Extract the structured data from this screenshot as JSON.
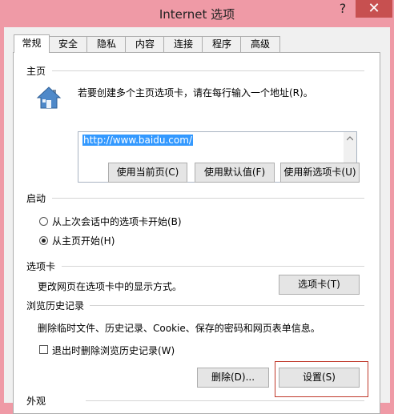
{
  "window": {
    "title": "Internet 选项",
    "help_glyph": "?",
    "close_glyph": "✕"
  },
  "tabs": [
    {
      "label": "常规",
      "active": true
    },
    {
      "label": "安全"
    },
    {
      "label": "隐私"
    },
    {
      "label": "内容"
    },
    {
      "label": "连接"
    },
    {
      "label": "程序"
    },
    {
      "label": "高级"
    }
  ],
  "home": {
    "title": "主页",
    "instruction": "若要创建多个主页选项卡，请在每行输入一个地址(R)。",
    "url": "http://www.baidu.com/",
    "buttons": {
      "current": "使用当前页(C)",
      "default": "使用默认值(F)",
      "new_tab": "使用新选项卡(U)"
    }
  },
  "startup": {
    "title": "启动",
    "options": [
      {
        "label": "从上次会话中的选项卡开始(B)",
        "selected": false
      },
      {
        "label": "从主页开始(H)",
        "selected": true
      }
    ]
  },
  "tabsection": {
    "title": "选项卡",
    "description": "更改网页在选项卡中的显示方式。",
    "button": "选项卡(T)"
  },
  "history": {
    "title": "浏览历史记录",
    "description": "删除临时文件、历史记录、Cookie、保存的密码和网页表单信息。",
    "checkbox_label": "退出时删除浏览历史记录(W)",
    "checkbox_checked": false,
    "delete_button": "删除(D)...",
    "settings_button": "设置(S)"
  },
  "appearance": {
    "title": "外观"
  },
  "colors": {
    "highlight": "#c0392b",
    "selection": "#3399ff",
    "titlebar": "#ef9aa6",
    "close": "#c75050"
  }
}
